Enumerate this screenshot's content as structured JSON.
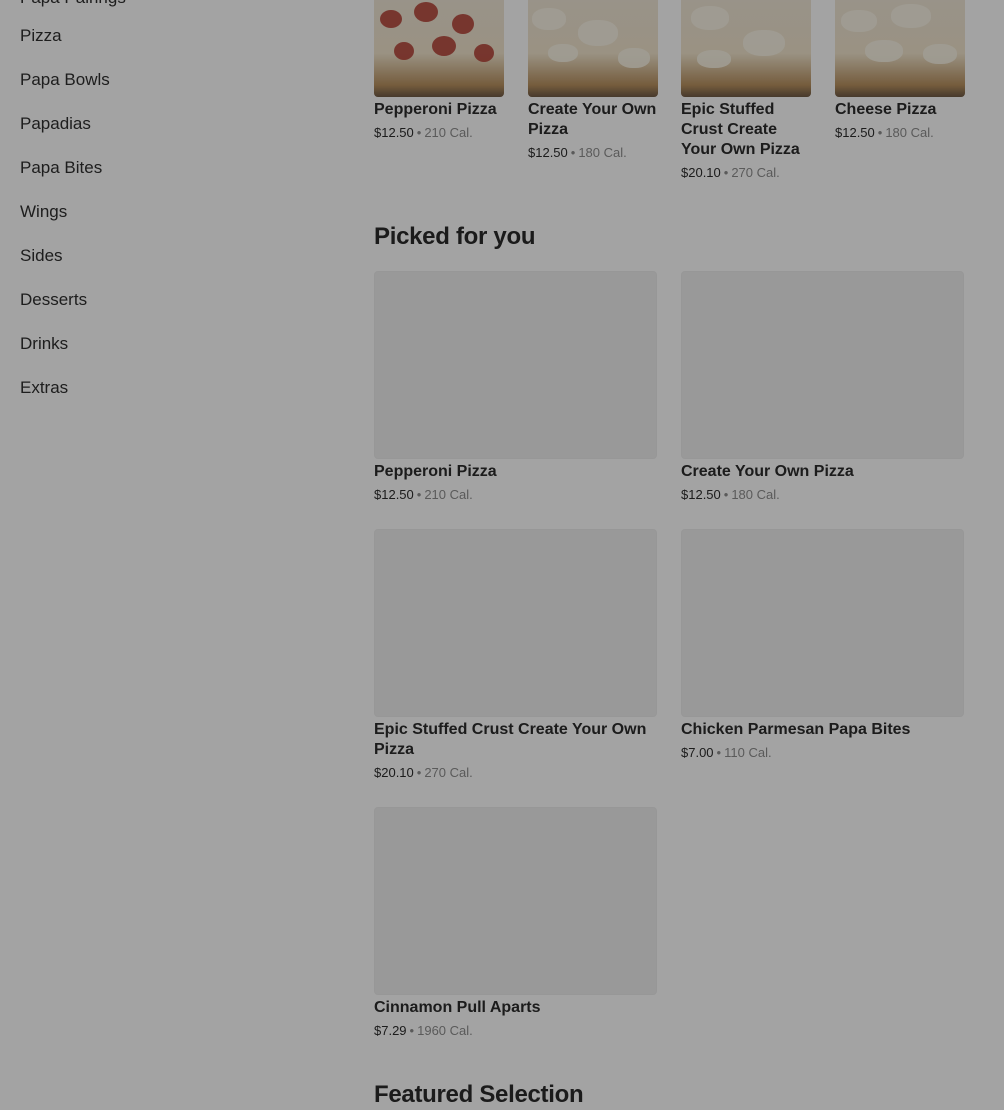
{
  "sidebar": {
    "items": [
      {
        "label": "Papa Pairings"
      },
      {
        "label": "Pizza"
      },
      {
        "label": "Papa Bowls"
      },
      {
        "label": "Papadias"
      },
      {
        "label": "Papa Bites"
      },
      {
        "label": "Wings"
      },
      {
        "label": "Sides"
      },
      {
        "label": "Desserts"
      },
      {
        "label": "Drinks"
      },
      {
        "label": "Extras"
      }
    ]
  },
  "top_row": [
    {
      "name": "Pepperoni Pizza",
      "price": "$12.50",
      "cal": "210 Cal."
    },
    {
      "name": "Create Your Own Pizza",
      "price": "$12.50",
      "cal": "180 Cal."
    },
    {
      "name": "Epic Stuffed Crust Create Your Own Pizza",
      "price": "$20.10",
      "cal": "270 Cal."
    },
    {
      "name": "Cheese Pizza",
      "price": "$12.50",
      "cal": "180 Cal."
    }
  ],
  "picked": {
    "title": "Picked for you",
    "items": [
      {
        "name": "Pepperoni Pizza",
        "price": "$12.50",
        "cal": "210 Cal."
      },
      {
        "name": "Create Your Own Pizza",
        "price": "$12.50",
        "cal": "180 Cal."
      },
      {
        "name": "Epic Stuffed Crust Create Your Own Pizza",
        "price": "$20.10",
        "cal": "270 Cal."
      },
      {
        "name": "Chicken Parmesan Papa Bites",
        "price": "$7.00",
        "cal": "110 Cal."
      },
      {
        "name": "Cinnamon Pull Aparts",
        "price": "$7.29",
        "cal": "1960 Cal."
      }
    ]
  },
  "featured": {
    "title": "Featured Selection"
  },
  "separator": "•"
}
